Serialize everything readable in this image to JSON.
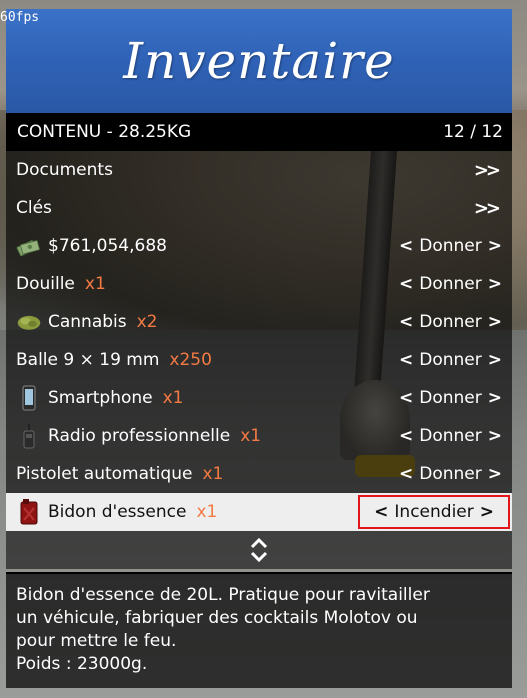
{
  "overlay": {
    "fps": "60fps"
  },
  "menu": {
    "title": "Inventaire",
    "header": {
      "left": "CONTENU - 28.25KG",
      "right": "12 / 12"
    },
    "items": [
      {
        "label": "Documents",
        "type": "submenu",
        "icon": ""
      },
      {
        "label": "Clés",
        "type": "submenu",
        "icon": ""
      },
      {
        "label": "$761,054,688",
        "type": "action",
        "action": "Donner",
        "icon": "cash-stack-icon"
      },
      {
        "label": "Douille",
        "qty": "x1",
        "type": "action",
        "action": "Donner",
        "icon": ""
      },
      {
        "label": "Cannabis",
        "qty": "x2",
        "type": "action",
        "action": "Donner",
        "icon": "cannabis-icon"
      },
      {
        "label": "Balle 9 × 19 mm",
        "qty": "x250",
        "type": "action",
        "action": "Donner",
        "icon": ""
      },
      {
        "label": "Smartphone",
        "qty": "x1",
        "type": "action",
        "action": "Donner",
        "icon": "smartphone-icon"
      },
      {
        "label": "Radio professionnelle",
        "qty": "x1",
        "type": "action",
        "action": "Donner",
        "icon": "radio-icon"
      },
      {
        "label": "Pistolet automatique",
        "qty": "x1",
        "type": "action",
        "action": "Donner",
        "icon": ""
      },
      {
        "label": "Bidon d'essence",
        "qty": "x1",
        "type": "action",
        "action": "Incendier",
        "icon": "jerrycan-icon",
        "selected": true
      }
    ],
    "description": {
      "line1": "Bidon d'essence de 20L. Pratique pour ravitailler",
      "line2": "un véhicule, fabriquer des cocktails Molotov ou",
      "line3": "pour mettre le feu.",
      "line4": "Poids : 23000g."
    },
    "colors": {
      "banner": "#2f62b6",
      "quantity": "#f47a44",
      "highlight_border": "#e0161b",
      "selected_row": "#eeeeee"
    }
  }
}
